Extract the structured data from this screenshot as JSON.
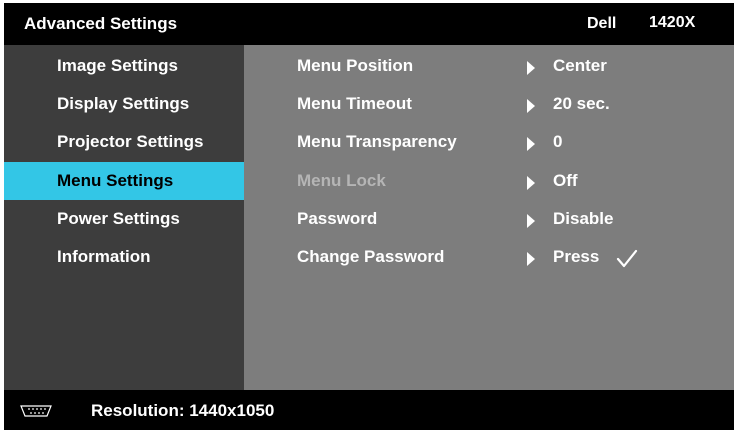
{
  "header": {
    "title": "Advanced Settings",
    "brand": "Dell",
    "model": "1420X"
  },
  "sidebar": {
    "items": [
      {
        "label": "Image Settings",
        "active": false
      },
      {
        "label": "Display Settings",
        "active": false
      },
      {
        "label": "Projector Settings",
        "active": false
      },
      {
        "label": "Menu Settings",
        "active": true
      },
      {
        "label": "Power Settings",
        "active": false
      },
      {
        "label": "Information",
        "active": false
      }
    ]
  },
  "main": {
    "rows": [
      {
        "label": "Menu Position",
        "value": "Center"
      },
      {
        "label": "Menu Timeout",
        "value": "20 sec."
      },
      {
        "label": "Menu Transparency",
        "value": "0"
      },
      {
        "label": "Menu Lock",
        "value": "Off",
        "disabled": true
      },
      {
        "label": "Password",
        "value": "Disable"
      },
      {
        "label": "Change Password",
        "value": "Press",
        "icon": "checkmark-icon"
      }
    ]
  },
  "footer": {
    "icon": "vga-port-icon",
    "resolution": "Resolution: 1440x1050"
  },
  "colors": {
    "highlight": "#33c6e6",
    "sidebar": "#3d3d3d",
    "panel": "#7d7d7d",
    "frame": "#000000"
  }
}
